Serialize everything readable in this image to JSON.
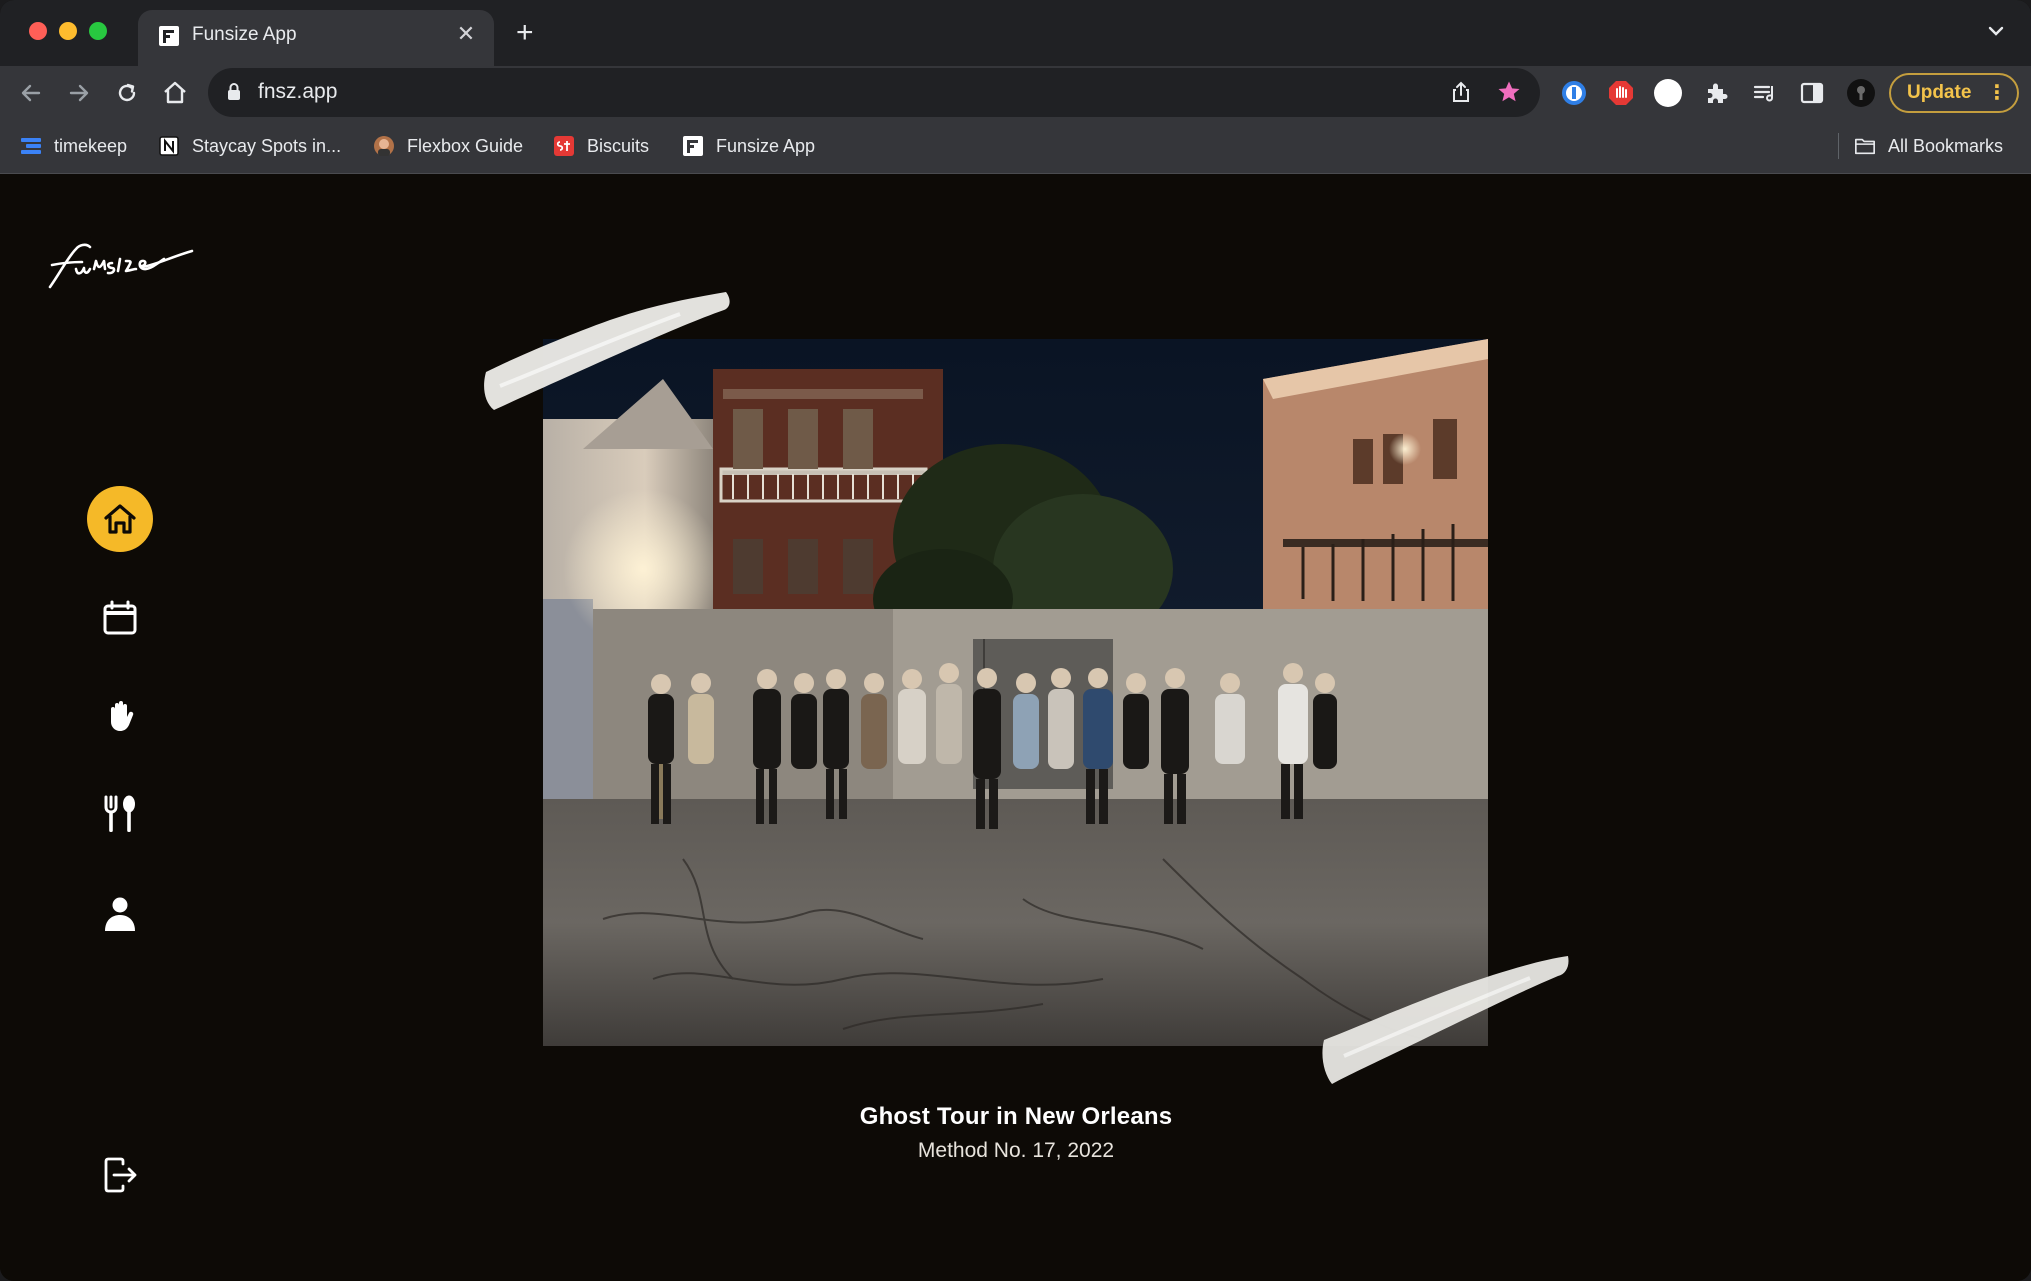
{
  "browser": {
    "tab": {
      "title": "Funsize App"
    },
    "address_bar": {
      "url": "fnsz.app"
    },
    "update_label": "Update",
    "bookmarks": [
      {
        "label": "timekeep"
      },
      {
        "label": "Staycay Spots in..."
      },
      {
        "label": "Flexbox Guide"
      },
      {
        "label": "Biscuits"
      },
      {
        "label": "Funsize App"
      }
    ],
    "all_bookmarks_label": "All Bookmarks"
  },
  "app": {
    "sidebar": {
      "items": [
        {
          "icon": "home-icon",
          "active": true
        },
        {
          "icon": "calendar-icon",
          "active": false
        },
        {
          "icon": "hand-icon",
          "active": false
        },
        {
          "icon": "fork-spoon-icon",
          "active": false
        },
        {
          "icon": "user-icon",
          "active": false
        }
      ],
      "logout_icon": "logout-icon"
    },
    "feature": {
      "title": "Ghost Tour in New Orleans",
      "subtitle": "Method No. 17, 2022"
    }
  },
  "colors": {
    "page_background": "#0d0a06",
    "accent": "#f5b928",
    "update_text": "#f3c34b",
    "star": "#f06ebe"
  }
}
